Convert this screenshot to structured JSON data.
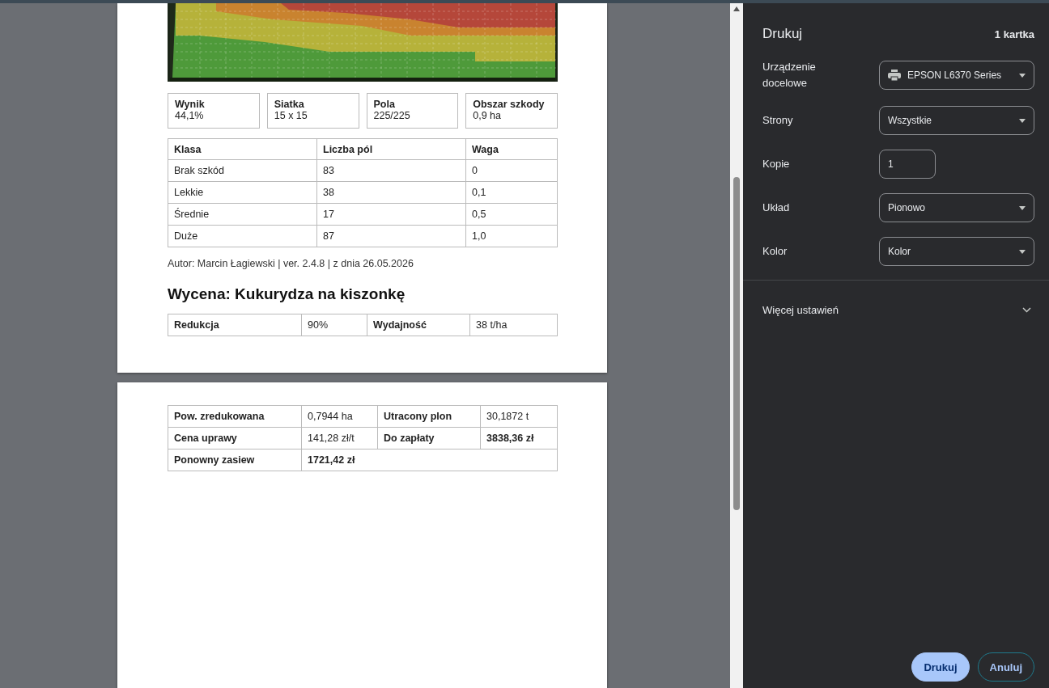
{
  "preview": {
    "pages": [
      {
        "picture": {
          "kind": "picture"
        },
        "stats": [
          {
            "label": "Wynik",
            "value": "44,1%"
          },
          {
            "label": "Siatka",
            "value": "15 x 15"
          },
          {
            "label": "Pola",
            "value": "225/225"
          },
          {
            "label": "Obszar szkody",
            "value": "0,9 ha"
          }
        ],
        "class_table": {
          "columns": [
            "Klasa",
            "Liczba pól",
            "Waga"
          ],
          "rows": [
            [
              "Brak szkód",
              "83",
              "0"
            ],
            [
              "Lekkie",
              "38",
              "0,1"
            ],
            [
              "Średnie",
              "17",
              "0,5"
            ],
            [
              "Duże",
              "87",
              "1,0"
            ]
          ]
        },
        "footer": "Autor: Marcin Łagiewski | ver. 2.4.8 | z dnia 26.05.2026",
        "heading": "Wycena: Kukurydza na kiszonkę",
        "valuation": [
          [
            {
              "label": "Redukcja",
              "value": "90%",
              "bold": false
            },
            {
              "label": "Wydajność",
              "value": "38 t/ha",
              "bold": false
            }
          ]
        ]
      },
      {
        "valuation": [
          [
            {
              "label": "Pow. zredukowana",
              "value": "0,7944 ha",
              "bold": false
            },
            {
              "label": "Utracony plon",
              "value": "30,1872 t",
              "bold": false
            }
          ],
          [
            {
              "label": "Cena uprawy",
              "value": "141,28 zł/t",
              "bold": false
            },
            {
              "label": "Do zapłaty",
              "value": "3838,36 zł",
              "bold": true
            }
          ],
          [
            {
              "label": "Ponowny zasiew",
              "value": "1721,42 zł",
              "bold": true
            }
          ]
        ]
      }
    ]
  },
  "panel": {
    "title": "Drukuj",
    "sheets": "1 kartka",
    "settings": [
      {
        "label": "Urządzenie docelowe",
        "kind": "device",
        "value": "EPSON L6370 Series"
      },
      {
        "label": "Strony",
        "kind": "select",
        "value": "Wszystkie"
      },
      {
        "label": "Kopie",
        "kind": "number",
        "value": "1"
      },
      {
        "label": "Układ",
        "kind": "select",
        "value": "Pionowo"
      },
      {
        "label": "Kolor",
        "kind": "select",
        "value": "Kolor"
      }
    ],
    "more_settings": {
      "label": "Więcej ustawień",
      "expanded": false
    },
    "buttons": [
      {
        "label": "Drukuj",
        "kind": "primary"
      },
      {
        "label": "Anuluj",
        "kind": "secondary"
      }
    ]
  }
}
